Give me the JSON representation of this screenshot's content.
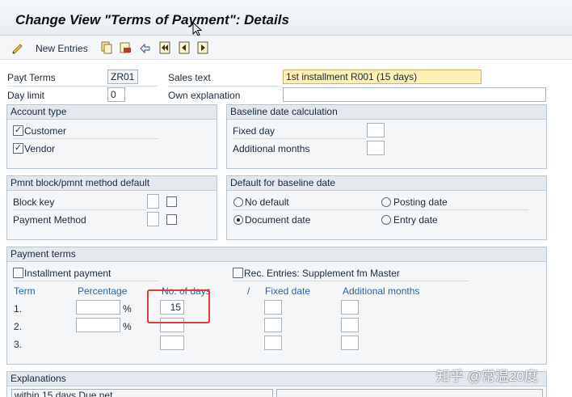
{
  "window": {
    "title": "Change View \"Terms of Payment\": Details"
  },
  "toolbar": {
    "new_entries_label": "New Entries",
    "icons": [
      "display-change-icon",
      "copy-icon",
      "delete-icon",
      "undo-icon",
      "first-page-icon",
      "previous-page-icon",
      "next-page-icon"
    ]
  },
  "header": {
    "payt_terms_label": "Payt Terms",
    "payt_terms_value": "ZR01",
    "sales_text_label": "Sales text",
    "sales_text_value": "1st installment R001 (15 days)",
    "day_limit_label": "Day limit",
    "day_limit_value": "0",
    "own_explanation_label": "Own explanation",
    "own_explanation_value": ""
  },
  "account_type": {
    "title": "Account type",
    "customer_label": "Customer",
    "customer_checked": true,
    "vendor_label": "Vendor",
    "vendor_checked": true
  },
  "baseline_calc": {
    "title": "Baseline date calculation",
    "fixed_day_label": "Fixed day",
    "additional_months_label": "Additional months"
  },
  "pmnt_block": {
    "title": "Pmnt block/pmnt method default",
    "block_key_label": "Block key",
    "payment_method_label": "Payment Method"
  },
  "default_baseline": {
    "title": "Default for baseline date",
    "options": [
      "No default",
      "Posting date",
      "Document date",
      "Entry date"
    ],
    "selected": "Document date"
  },
  "payment_terms": {
    "title": "Payment terms",
    "installment_label": "Installment payment",
    "rec_entries_label": "Rec. Entries: Supplement fm Master",
    "columns": [
      "Term",
      "Percentage",
      "No. of days",
      "/",
      "Fixed date",
      "Additional months"
    ],
    "rows": [
      {
        "term": "1.",
        "percent_sign": "%",
        "days": "15"
      },
      {
        "term": "2.",
        "percent_sign": "%",
        "days": ""
      },
      {
        "term": "3.",
        "percent_sign": "",
        "days": ""
      }
    ]
  },
  "explanations": {
    "title": "Explanations",
    "text": "within 15 days Due net"
  },
  "watermark": "知乎 @常温20度"
}
